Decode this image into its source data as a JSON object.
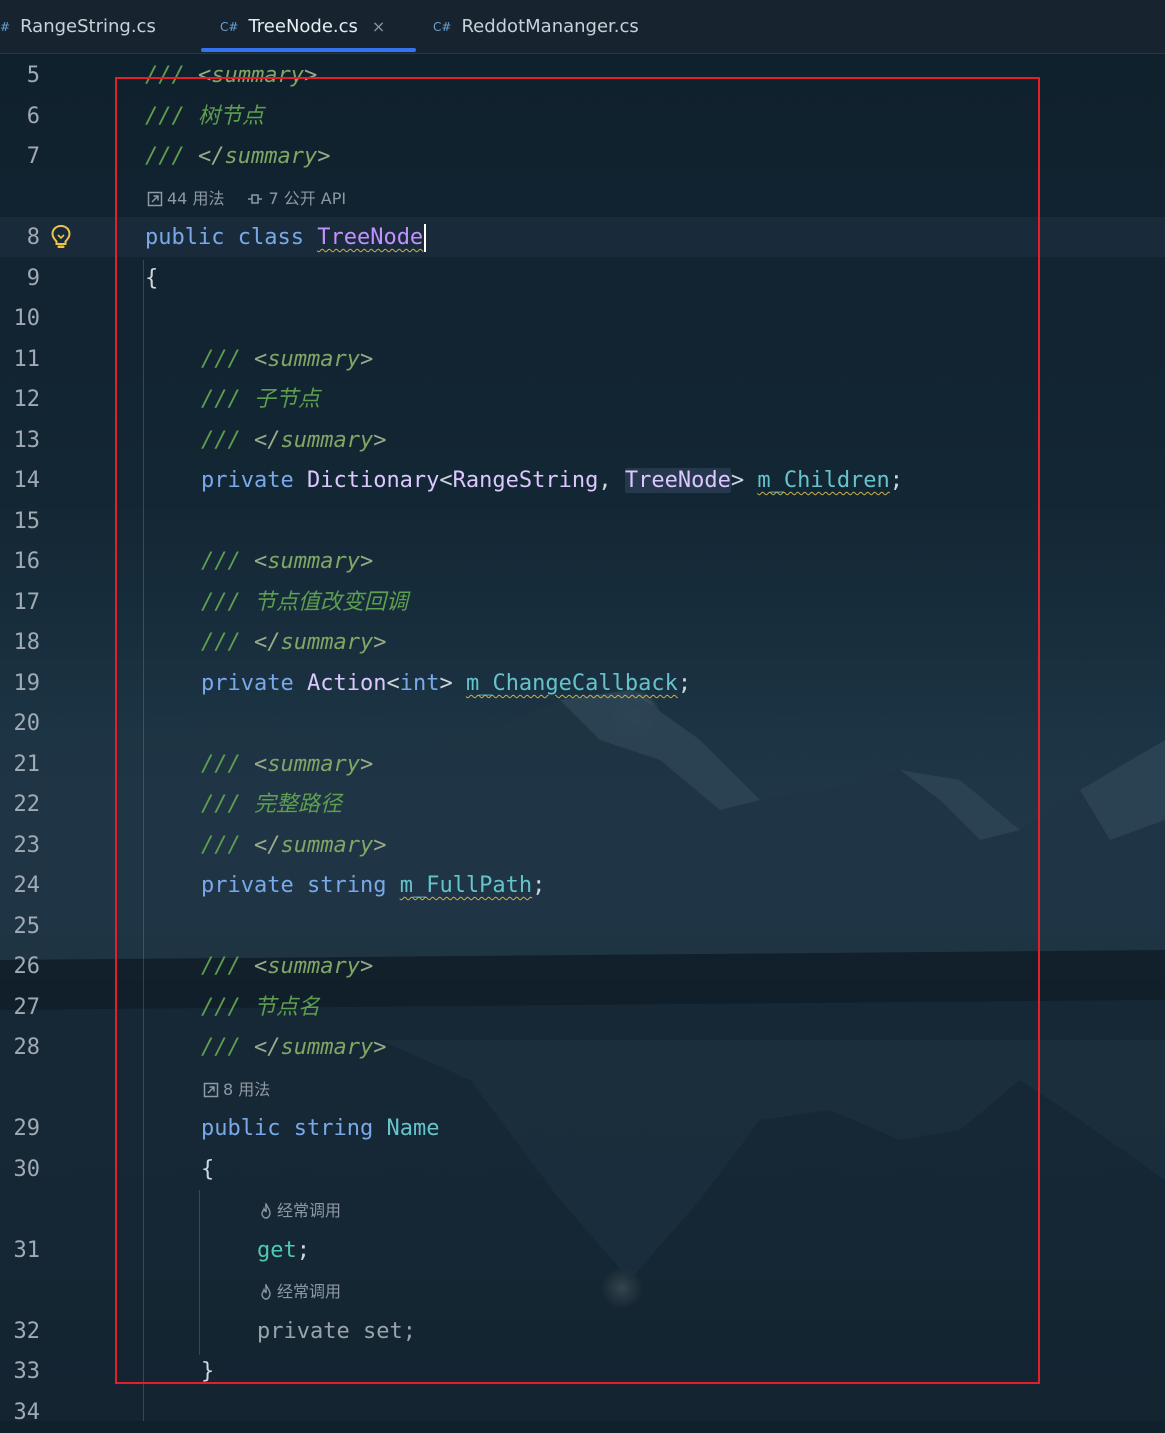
{
  "tabs": [
    {
      "lang": "#",
      "label": "RangeString.cs",
      "active": false
    },
    {
      "lang": "C#",
      "label": "TreeNode.cs",
      "active": true,
      "close": "×"
    },
    {
      "lang": "C#",
      "label": "ReddotMananger.cs",
      "active": false
    }
  ],
  "line_numbers": [
    "5",
    "6",
    "7",
    "8",
    "9",
    "10",
    "11",
    "12",
    "13",
    "14",
    "15",
    "16",
    "17",
    "18",
    "19",
    "20",
    "21",
    "22",
    "23",
    "24",
    "25",
    "26",
    "27",
    "28",
    "29",
    "30",
    "31",
    "32",
    "33",
    "34"
  ],
  "code": {
    "l5": {
      "slashes": "///",
      "open": "<",
      "tag": "summary",
      "close": ">"
    },
    "l6": {
      "slashes": "///",
      "text": "树节点"
    },
    "l7": {
      "slashes": "///",
      "open": "</",
      "tag": "summary",
      "close": ">"
    },
    "hint_class": {
      "usages": "44 用法",
      "api": "7 公开 API"
    },
    "l8": {
      "kw1": "public",
      "kw2": "class",
      "name": "TreeNode"
    },
    "l9": {
      "text": "{"
    },
    "l11": {
      "slashes": "///",
      "open": "<",
      "tag": "summary",
      "close": ">"
    },
    "l12": {
      "slashes": "///",
      "text": "子节点"
    },
    "l13": {
      "slashes": "///",
      "open": "</",
      "tag": "summary",
      "close": ">"
    },
    "l14": {
      "kw": "private",
      "type": "Dictionary",
      "lt": "<",
      "arg1": "RangeString",
      "comma": ", ",
      "arg2": "TreeNode",
      "gt": ">",
      "field": "m_Children",
      "semi": ";"
    },
    "l16": {
      "slashes": "///",
      "open": "<",
      "tag": "summary",
      "close": ">"
    },
    "l17": {
      "slashes": "///",
      "text": "节点值改变回调"
    },
    "l18": {
      "slashes": "///",
      "open": "</",
      "tag": "summary",
      "close": ">"
    },
    "l19": {
      "kw": "private",
      "type": "Action",
      "lt": "<",
      "arg": "int",
      "gt": ">",
      "field": "m_ChangeCallback",
      "semi": ";"
    },
    "l21": {
      "slashes": "///",
      "open": "<",
      "tag": "summary",
      "close": ">"
    },
    "l22": {
      "slashes": "///",
      "text": "完整路径"
    },
    "l23": {
      "slashes": "///",
      "open": "</",
      "tag": "summary",
      "close": ">"
    },
    "l24": {
      "kw": "private",
      "type": "string",
      "field": "m_FullPath",
      "semi": ";"
    },
    "l26": {
      "slashes": "///",
      "open": "<",
      "tag": "summary",
      "close": ">"
    },
    "l27": {
      "slashes": "///",
      "text": "节点名"
    },
    "l28": {
      "slashes": "///",
      "open": "</",
      "tag": "summary",
      "close": ">"
    },
    "hint_name": {
      "usages": "8 用法"
    },
    "l29": {
      "kw": "public",
      "type": "string",
      "name": "Name"
    },
    "l30": {
      "text": "{"
    },
    "hint_get": {
      "text": "经常调用"
    },
    "l31": {
      "text": "get",
      "semi": ";"
    },
    "hint_set": {
      "text": "经常调用"
    },
    "l32": {
      "text": "private set;"
    },
    "l33": {
      "text": "}"
    }
  },
  "icons": {
    "usages": "link-arrow-icon",
    "api": "api-icon",
    "hot": "flame-icon",
    "bulb": "lightbulb-icon"
  },
  "colors": {
    "highlight_box": "#e21f2a",
    "tab_underline": "#3574f0"
  }
}
